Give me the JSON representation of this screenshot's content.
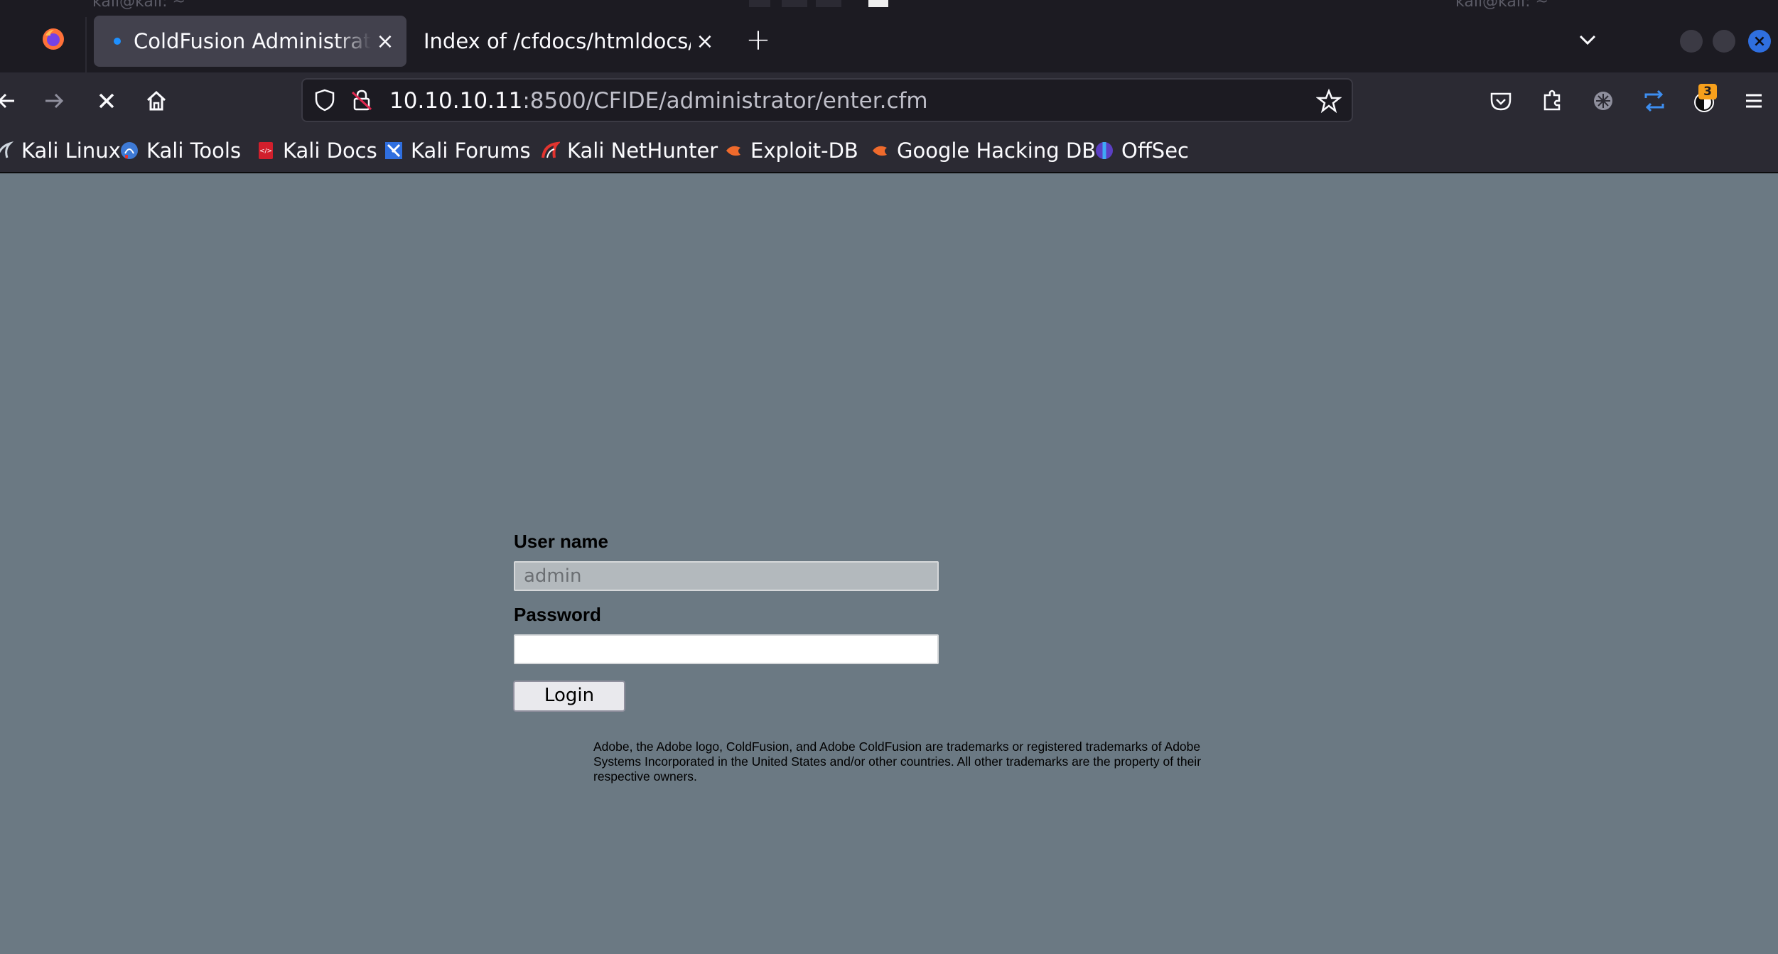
{
  "desktop": {
    "terminal_title_left": "kali@kali: ~",
    "terminal_title_right": "kali@kali: ~"
  },
  "tabs": [
    {
      "title": "ColdFusion Administrator",
      "active": true
    },
    {
      "title": "Index of /cfdocs/htmldocs/",
      "active": false
    }
  ],
  "navbar": {
    "url_host": "10.10.10.11",
    "url_rest": ":8500/CFIDE/administrator/enter.cfm",
    "extension_badge": "3"
  },
  "bookmarks": [
    {
      "label": "Kali Linux",
      "icon": "kali-dragon-icon"
    },
    {
      "label": "Kali Tools",
      "icon": "kali-tools-icon"
    },
    {
      "label": "Kali Docs",
      "icon": "kali-docs-icon"
    },
    {
      "label": "Kali Forums",
      "icon": "kali-forums-icon"
    },
    {
      "label": "Kali NetHunter",
      "icon": "nethunter-icon"
    },
    {
      "label": "Exploit-DB",
      "icon": "exploit-db-icon"
    },
    {
      "label": "Google Hacking DB",
      "icon": "ghdb-icon"
    },
    {
      "label": "OffSec",
      "icon": "offsec-icon"
    }
  ],
  "login": {
    "username_label": "User name",
    "username_value": "admin",
    "password_label": "Password",
    "password_value": "",
    "login_button": "Login",
    "legal_text": "Adobe, the Adobe logo, ColdFusion, and Adobe ColdFusion are trademarks or registered trademarks of Adobe Systems Incorporated in the United States and/or other countries. All other trademarks are the property of their respective owners."
  },
  "colors": {
    "page_background": "#6b7983",
    "toolbar": "#2b2a33",
    "tabbar": "#1c1b22",
    "active_tab": "#42414d",
    "accent_blue": "#2f6fe0",
    "badge": "#f7a01c"
  }
}
